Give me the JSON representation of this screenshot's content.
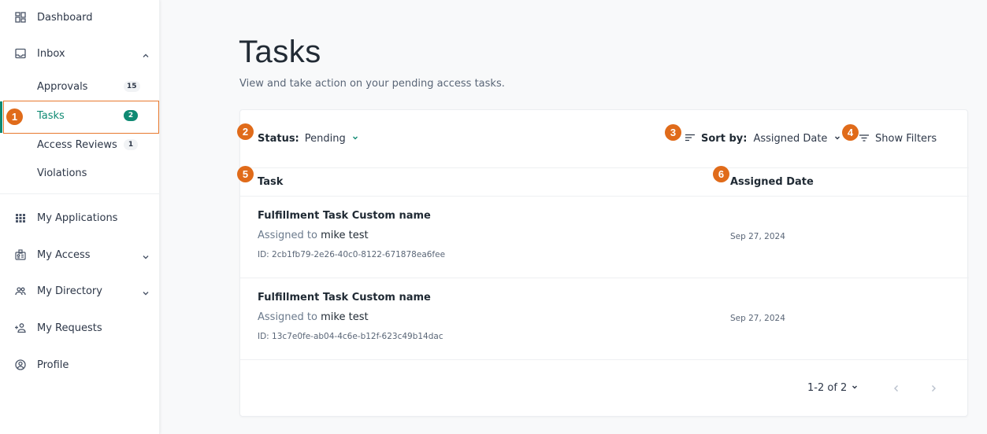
{
  "sidebar": {
    "items": [
      {
        "label": "Dashboard",
        "icon": "dashboard-icon"
      },
      {
        "label": "Inbox",
        "icon": "inbox-icon",
        "expanded": true
      },
      {
        "label": "My Applications",
        "icon": "apps-grid-icon"
      },
      {
        "label": "My Access",
        "icon": "badge-icon",
        "expanded": false
      },
      {
        "label": "My Directory",
        "icon": "people-icon",
        "expanded": false
      },
      {
        "label": "My Requests",
        "icon": "person-add-icon"
      },
      {
        "label": "Profile",
        "icon": "profile-circle-icon"
      }
    ],
    "inbox_children": [
      {
        "label": "Approvals",
        "count": "15"
      },
      {
        "label": "Tasks",
        "count": "2",
        "active": true
      },
      {
        "label": "Access Reviews",
        "count": "1"
      },
      {
        "label": "Violations"
      }
    ]
  },
  "markers": [
    "1",
    "2",
    "3",
    "4",
    "5",
    "6"
  ],
  "page": {
    "title": "Tasks",
    "subtitle": "View and take action on your pending access tasks."
  },
  "toolbar": {
    "status_label": "Status:",
    "status_value": "Pending",
    "sort_label": "Sort by:",
    "sort_value": "Assigned Date",
    "filters_label": "Show Filters"
  },
  "table": {
    "columns": [
      "Task",
      "Assigned Date"
    ],
    "rows": [
      {
        "title": "Fulfillment Task Custom name",
        "assigned_prefix": "Assigned to",
        "assignee": "mike test",
        "id": "ID: 2cb1fb79-2e26-40c0-8122-671878ea6fee",
        "date": "Sep 27, 2024"
      },
      {
        "title": "Fulfillment Task Custom name",
        "assigned_prefix": "Assigned to",
        "assignee": "mike test",
        "id": "ID: 13c7e0fe-ab04-4c6e-b12f-623c49b14dac",
        "date": "Sep 27, 2024"
      }
    ]
  },
  "pagination": {
    "range": "1-2 of 2"
  },
  "colors": {
    "accent": "#0f8a73",
    "marker": "#e06b1a"
  }
}
